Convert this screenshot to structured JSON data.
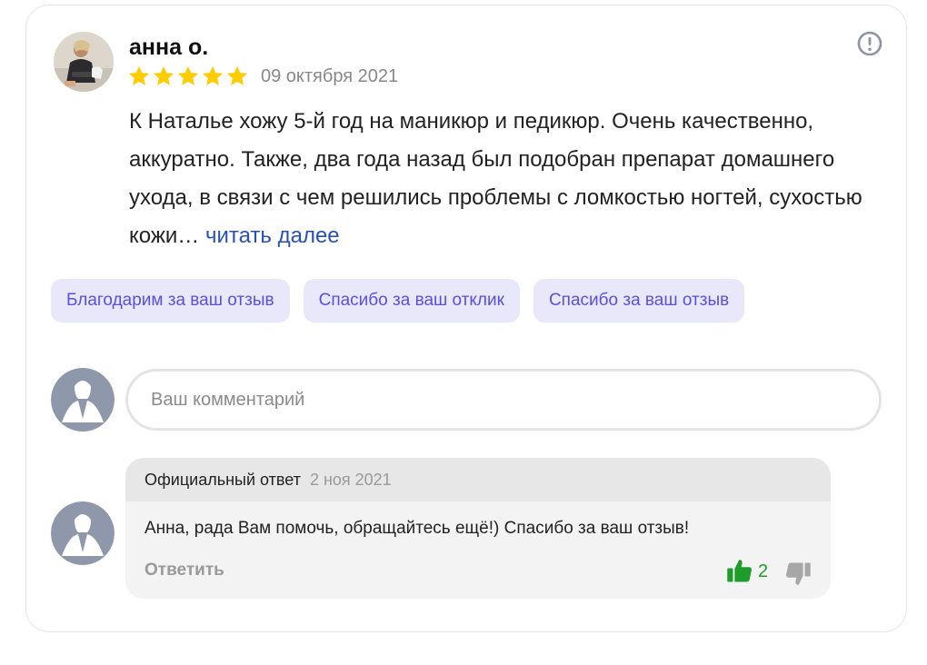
{
  "review": {
    "author": "анна о.",
    "rating": 5,
    "date": "09 октября 2021",
    "text": "К Наталье хожу 5-й год на маникюр и педикюр. Очень качественно, аккуратно. Также, два года назад был подобран препарат домашнего ухода, в связи с чем решились проблемы с ломкостью ногтей, сухостью кожи…",
    "read_more": "читать далее"
  },
  "chips": [
    {
      "label": "Благодарим за ваш отзыв"
    },
    {
      "label": "Спасибо за ваш отклик"
    },
    {
      "label": "Спасибо за ваш отзыв"
    }
  ],
  "comment": {
    "placeholder": "Ваш комментарий"
  },
  "reply": {
    "label": "Официальный ответ",
    "date": "2 ноя 2021",
    "text": "Анна, рада Вам помочь, обращайтесь ещё!) Спасибо за ваш отзыв!",
    "reply_button": "Ответить",
    "likes": "2"
  },
  "colors": {
    "star": "#ffcc00",
    "chip_bg": "#e9e8fb",
    "chip_text": "#5b4fe0",
    "link": "#2950b5",
    "like": "#1f9d2b",
    "anon_avatar": "#8e98aa"
  },
  "icons": {
    "report": "exclamation-circle-icon",
    "star": "star-icon",
    "like": "thumbs-up-icon",
    "dislike": "thumbs-down-icon"
  }
}
